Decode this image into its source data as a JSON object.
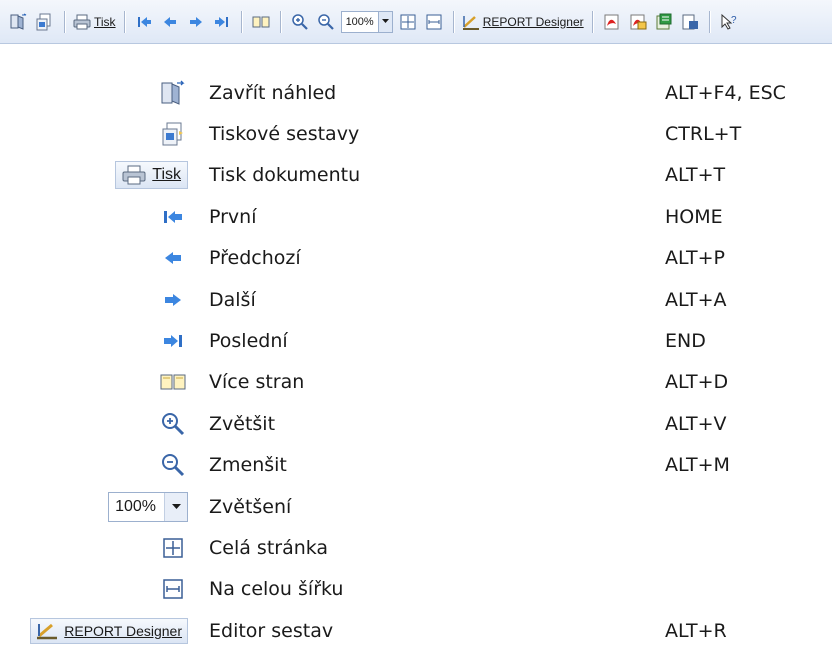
{
  "toolbar": {
    "print_label": "Tisk",
    "zoom_value": "100%",
    "report_label": "REPORT Designer"
  },
  "legend": [
    {
      "icon": "close-preview-icon",
      "label": "Zavřít náhled",
      "shortcut": "ALT+F4, ESC"
    },
    {
      "icon": "print-reports-icon",
      "label": "Tiskové sestavy",
      "shortcut": "CTRL+T"
    },
    {
      "icon": "print-button",
      "icon_text": "Tisk",
      "label": "Tisk dokumentu",
      "shortcut": "ALT+T"
    },
    {
      "icon": "first-page-icon",
      "label": "První",
      "shortcut": "HOME"
    },
    {
      "icon": "previous-page-icon",
      "label": "Předchozí",
      "shortcut": "ALT+P"
    },
    {
      "icon": "next-page-icon",
      "label": "Další",
      "shortcut": "ALT+A"
    },
    {
      "icon": "last-page-icon",
      "label": "Poslední",
      "shortcut": "END"
    },
    {
      "icon": "multiple-pages-icon",
      "label": "Více stran",
      "shortcut": "ALT+D"
    },
    {
      "icon": "zoom-in-icon",
      "label": "Zvětšit",
      "shortcut": "ALT+V"
    },
    {
      "icon": "zoom-out-icon",
      "label": "Zmenšit",
      "shortcut": "ALT+M"
    },
    {
      "icon": "zoom-combo",
      "icon_text": "100%",
      "label": "Zvětšení",
      "shortcut": ""
    },
    {
      "icon": "whole-page-icon",
      "label": "Celá stránka",
      "shortcut": ""
    },
    {
      "icon": "page-width-icon",
      "label": "Na celou šířku",
      "shortcut": ""
    },
    {
      "icon": "report-designer-button",
      "icon_text": "REPORT Designer",
      "label": "Editor sestav",
      "shortcut": "ALT+R"
    }
  ]
}
